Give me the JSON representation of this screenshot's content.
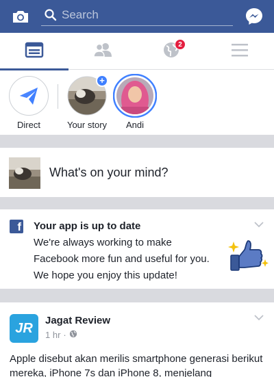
{
  "topbar": {
    "search_placeholder": "Search",
    "bg_color": "#3b5998"
  },
  "tabs": [
    {
      "name": "news-feed",
      "icon": "news-feed-icon",
      "active": true
    },
    {
      "name": "friends",
      "icon": "friends-icon",
      "active": false
    },
    {
      "name": "notifications",
      "icon": "globe-icon",
      "badge": "2"
    },
    {
      "name": "menu",
      "icon": "hamburger-icon",
      "active": false
    }
  ],
  "stories": [
    {
      "label": "Direct"
    },
    {
      "label": "Your story"
    },
    {
      "label": "Andi"
    }
  ],
  "composer": {
    "placeholder": "What's on your mind?"
  },
  "update_card": {
    "title": "Your app is up to date",
    "lines": [
      "We're always working to make",
      "Facebook more fun and useful for you.",
      "We hope you enjoy this update!"
    ]
  },
  "post": {
    "logo_text": "JR",
    "author": "Jagat Review",
    "time": "1 hr",
    "separator": "·",
    "text": "Apple disebut akan merilis smartphone generasi berikut mereka, iPhone 7s dan iPhone 8, menjelang"
  }
}
